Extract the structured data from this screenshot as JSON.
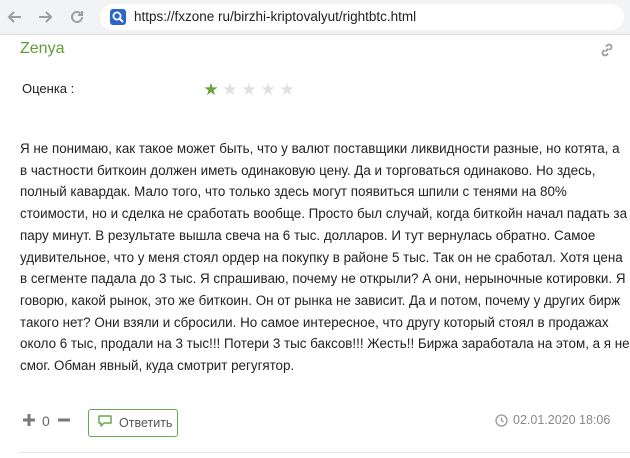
{
  "browser": {
    "url": "https://fxzone ru/birzhi-kriptovalyut/rightbtc.html",
    "back_icon": "arrow-left-icon",
    "forward_icon": "arrow-right-icon",
    "reload_icon": "reload-icon"
  },
  "review": {
    "author": "Zenya",
    "rating_label": "Оценка :",
    "rating": 1,
    "rating_max": 5,
    "text": "Я не понимаю, как такое может быть, что у валют поставщики ликвидности разные, но котята, а в частности биткоин должен иметь одинаковую цену. Да и торговаться одинаково. Но здесь, полный кавардак. Мало того, что только здесь могут появиться шпили с тенями на 80% стоимости, но и сделка не сработать вообще. Просто был случай, когда биткойн начал падать за пару минут. В результате вышла свеча на 6 тыс. долларов. И тут вернулась обратно. Самое удивительное, что у меня стоял ордер на покупку в районе 5 тыс. Так он не сработал. Хотя цена в сегменте падала до 3 тыс. Я спрашиваю, почему не открыли? А они, нерыночные котировки. Я говорю, какой рынок, это же биткоин. Он от рынка не зависит. Да и потом, почему у других бирж такого нет? Они взяли и сбросили. Но самое интересное, что другу который стоял в продажах около 6 тыс, продали на 3 тыс!!! Потери 3 тыс баксов!!! Жесть!! Биржа заработала на этом, а я не смог. Обман явный, куда смотрит регугятор.",
    "votes": "0",
    "reply_label": "Ответить",
    "date": "02.01.2020 18:06"
  },
  "colors": {
    "accent": "#68a33b",
    "author": "#5f9d3a",
    "star_off": "#e1e1e1"
  }
}
